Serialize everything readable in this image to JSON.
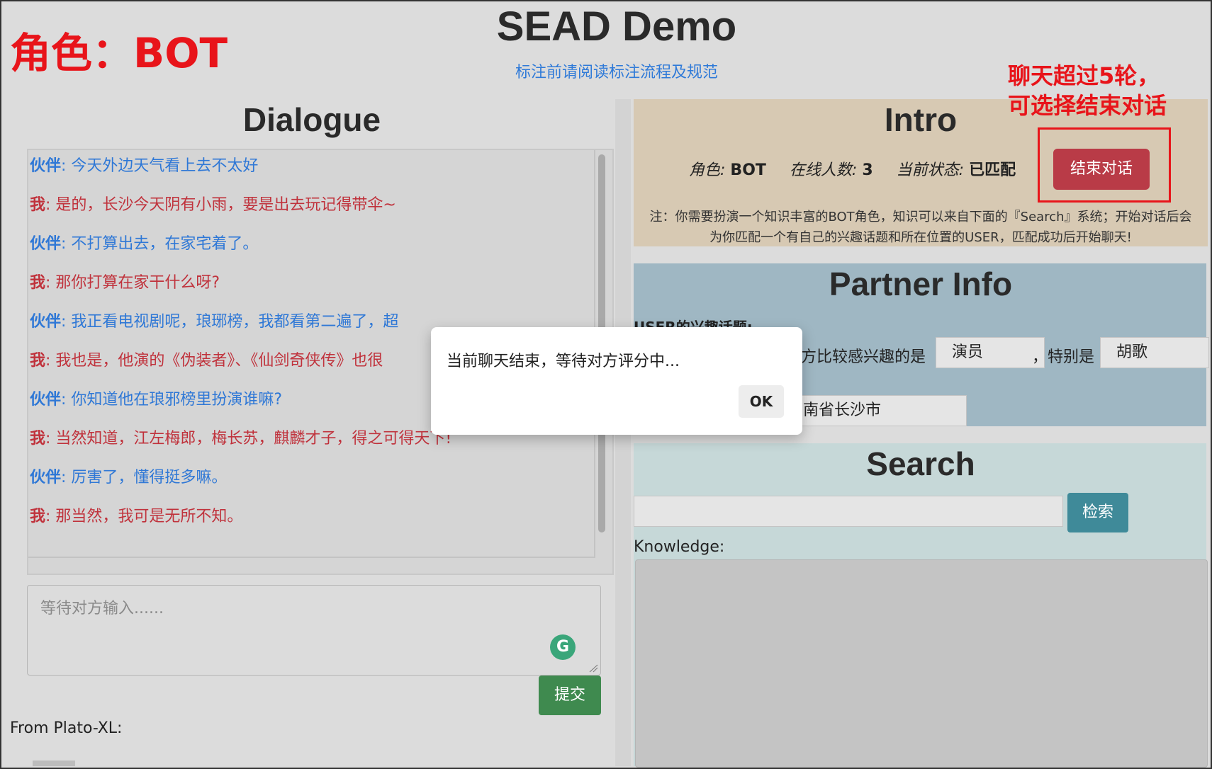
{
  "annotations": {
    "role": "角色：BOT",
    "end_hint_line1": "聊天超过5轮，",
    "end_hint_line2": "可选择结束对话",
    "highlight_color": "#e8141a"
  },
  "header": {
    "title": "SEAD Demo",
    "link": "标注前请阅读标注流程及规范"
  },
  "dialogue": {
    "title": "Dialogue",
    "messages": [
      {
        "speaker": "伙伴",
        "text": ": 今天外边天气看上去不太好",
        "role": "partner"
      },
      {
        "speaker": "我",
        "text": ": 是的，长沙今天阴有小雨，要是出去玩记得带伞~",
        "role": "me"
      },
      {
        "speaker": "伙伴",
        "text": ": 不打算出去，在家宅着了。",
        "role": "partner"
      },
      {
        "speaker": "我",
        "text": ": 那你打算在家干什么呀?",
        "role": "me"
      },
      {
        "speaker": "伙伴",
        "text": ": 我正看电视剧呢，琅琊榜，我都看第二遍了，超",
        "role": "partner"
      },
      {
        "speaker": "我",
        "text": ": 我也是，他演的《伪装者》、《仙剑奇侠传》也很",
        "role": "me"
      },
      {
        "speaker": "伙伴",
        "text": ": 你知道他在琅邪榜里扮演谁嘛?",
        "role": "partner"
      },
      {
        "speaker": "我",
        "text": ": 当然知道，江左梅郎，梅长苏，麒麟才子，得之可得天下!",
        "role": "me"
      },
      {
        "speaker": "伙伴",
        "text": ": 厉害了，懂得挺多嘛。",
        "role": "partner"
      },
      {
        "speaker": "我",
        "text": ": 那当然，我可是无所不知。",
        "role": "me"
      }
    ],
    "input_placeholder": "等待对方输入......",
    "submit_label": "提交",
    "from_label": "From Plato-XL:"
  },
  "intro": {
    "title": "Intro",
    "role_key": "角色:",
    "role_val": "BOT",
    "online_key": "在线人数:",
    "online_val": "3",
    "state_key": "当前状态:",
    "state_val": "已匹配",
    "end_button": "结束对话",
    "note_line1": "注：你需要扮演一个知识丰富的BOT角色，知识可以来自下面的『Search』系统；开始对话后会",
    "note_line2": "为你匹配一个有自己的兴趣话题和所在位置的USER，匹配成功后开始聊天!"
  },
  "partner": {
    "title": "Partner Info",
    "topics_label": "USER的兴趣话题:",
    "interest_text": "方比较感兴趣的是",
    "interest_value": "演员",
    "comma": "，",
    "special_label": "特别是",
    "special_value": "胡歌",
    "location_value": "南省长沙市"
  },
  "search": {
    "title": "Search",
    "button": "检索",
    "knowledge_label": "Knowledge:"
  },
  "modal": {
    "message": "当前聊天结束，等待对方评分中...",
    "ok": "OK"
  },
  "colors": {
    "partner_text": "#2f78d6",
    "me_text": "#c0323c",
    "intro_bg": "#d7c9b3",
    "partner_bg": "#9fb7c3",
    "search_bg": "#c6d8d8",
    "end_button": "#b93b47",
    "submit_button": "#3f8a4f",
    "search_button": "#3f8a99"
  }
}
